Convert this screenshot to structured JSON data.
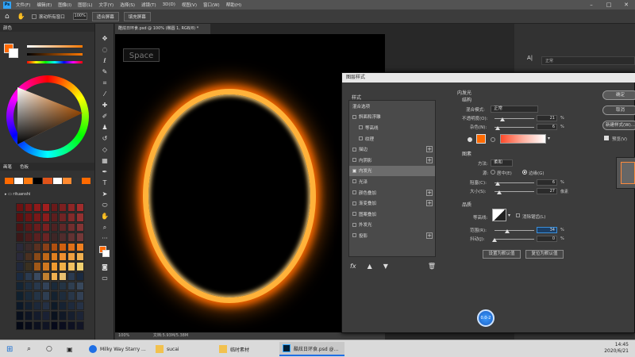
{
  "app": {
    "menu": [
      "文件(F)",
      "编辑(E)",
      "图像(I)",
      "图层(L)",
      "文字(Y)",
      "选择(S)",
      "滤镜(T)",
      "3D(D)",
      "视图(V)",
      "窗口(W)",
      "帮助(H)"
    ],
    "logo": "Ps"
  },
  "options_bar": {
    "scroll_all": "滚动所有窗口",
    "zoom": "100%",
    "fit_screen": "适合屏幕",
    "fill_screen": "填充屏幕"
  },
  "left_panel": {
    "color_tab": "颜色",
    "swatch_tabs": [
      "画笔",
      "色板"
    ],
    "swatch_group": "rituanshi"
  },
  "document": {
    "tab": "酷炫日环食.psd @ 100% (椭圆 1, RGB/8) *",
    "watermark": "Space",
    "status_zoom": "100%",
    "status_doc": "文档:5.93M/5.38M"
  },
  "right_panel": {
    "search_text": "正常",
    "top_char": "A|"
  },
  "dialog": {
    "title": "图层样式",
    "styles_header": "样式",
    "blend_options": "混合选项",
    "effects": [
      {
        "label": "斜面和浮雕",
        "checked": false,
        "plus": false,
        "indent": false
      },
      {
        "label": "等高线",
        "checked": false,
        "plus": false,
        "indent": true
      },
      {
        "label": "纹理",
        "checked": false,
        "plus": false,
        "indent": true
      },
      {
        "label": "描边",
        "checked": false,
        "plus": true,
        "indent": false
      },
      {
        "label": "内阴影",
        "checked": false,
        "plus": true,
        "indent": false
      },
      {
        "label": "内发光",
        "checked": true,
        "plus": false,
        "indent": false
      },
      {
        "label": "光泽",
        "checked": false,
        "plus": false,
        "indent": false
      },
      {
        "label": "颜色叠加",
        "checked": false,
        "plus": true,
        "indent": false
      },
      {
        "label": "渐变叠加",
        "checked": false,
        "plus": true,
        "indent": false
      },
      {
        "label": "图案叠加",
        "checked": false,
        "plus": false,
        "indent": false
      },
      {
        "label": "外发光",
        "checked": false,
        "plus": false,
        "indent": false
      },
      {
        "label": "投影",
        "checked": false,
        "plus": true,
        "indent": false
      }
    ],
    "fx": "fx",
    "inner_glow": {
      "section": "内发光",
      "structure": "结构",
      "blend_mode_label": "混合模式:",
      "blend_mode": "正常",
      "opacity_label": "不透明度(O):",
      "opacity": 21,
      "noise_label": "杂色(N):",
      "noise": 6,
      "elements": "图素",
      "method_label": "方法:",
      "method": "柔和",
      "source_label": "源:",
      "source_center": "居中(E)",
      "source_edge": "边缘(G)",
      "choke_label": "阻塞(C):",
      "choke": 6,
      "size_label": "大小(S):",
      "size": 27,
      "px": "像素",
      "quality": "品质",
      "contour_label": "等高线:",
      "anti_alias": "消除锯齿(L)",
      "range_label": "范围(R):",
      "range": 34,
      "jitter_label": "抖动(J):",
      "jitter": 0,
      "percent": "%",
      "set_default": "设置为默认值",
      "reset_default": "复位为默认值",
      "glow_color": "#ff6a00"
    },
    "buttons": {
      "ok": "确定",
      "cancel": "取消",
      "new_style": "新建样式(W)...",
      "preview": "预览(V)"
    }
  },
  "taskbar": {
    "items": [
      "Milky Way Starry ...",
      "sucai",
      "临时素材",
      "酷炫日环食.psd @..."
    ],
    "time": "14:45",
    "date": "2020/6/21"
  },
  "cursor_label": "0.0-2"
}
